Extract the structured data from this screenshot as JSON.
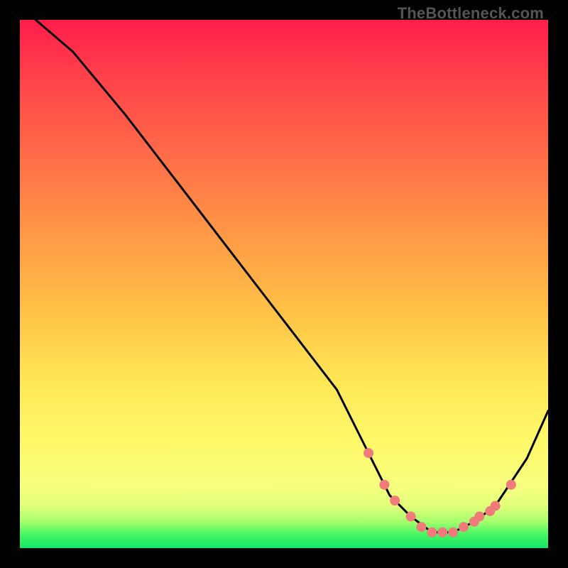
{
  "watermark": "TheBottleneck.com",
  "chart_data": {
    "type": "line",
    "title": "",
    "xlabel": "",
    "ylabel": "",
    "xlim": [
      0,
      100
    ],
    "ylim": [
      0,
      100
    ],
    "grid": false,
    "series": [
      {
        "name": "curve",
        "x": [
          3,
          10,
          20,
          30,
          40,
          50,
          60,
          66,
          70,
          74,
          78,
          82,
          86,
          90,
          96,
          100
        ],
        "y": [
          100,
          94,
          82,
          69,
          56,
          43,
          30,
          18,
          10,
          6,
          3,
          3,
          5,
          8,
          17,
          26
        ]
      }
    ],
    "markers": {
      "name": "highlight",
      "color": "#f17a7a",
      "x": [
        66,
        69,
        71,
        74,
        76,
        78,
        80,
        82,
        84,
        86,
        87,
        89,
        90,
        93
      ],
      "y": [
        18,
        12,
        9,
        6,
        4,
        3,
        3,
        3,
        4,
        5,
        6,
        7,
        8,
        12
      ]
    }
  }
}
